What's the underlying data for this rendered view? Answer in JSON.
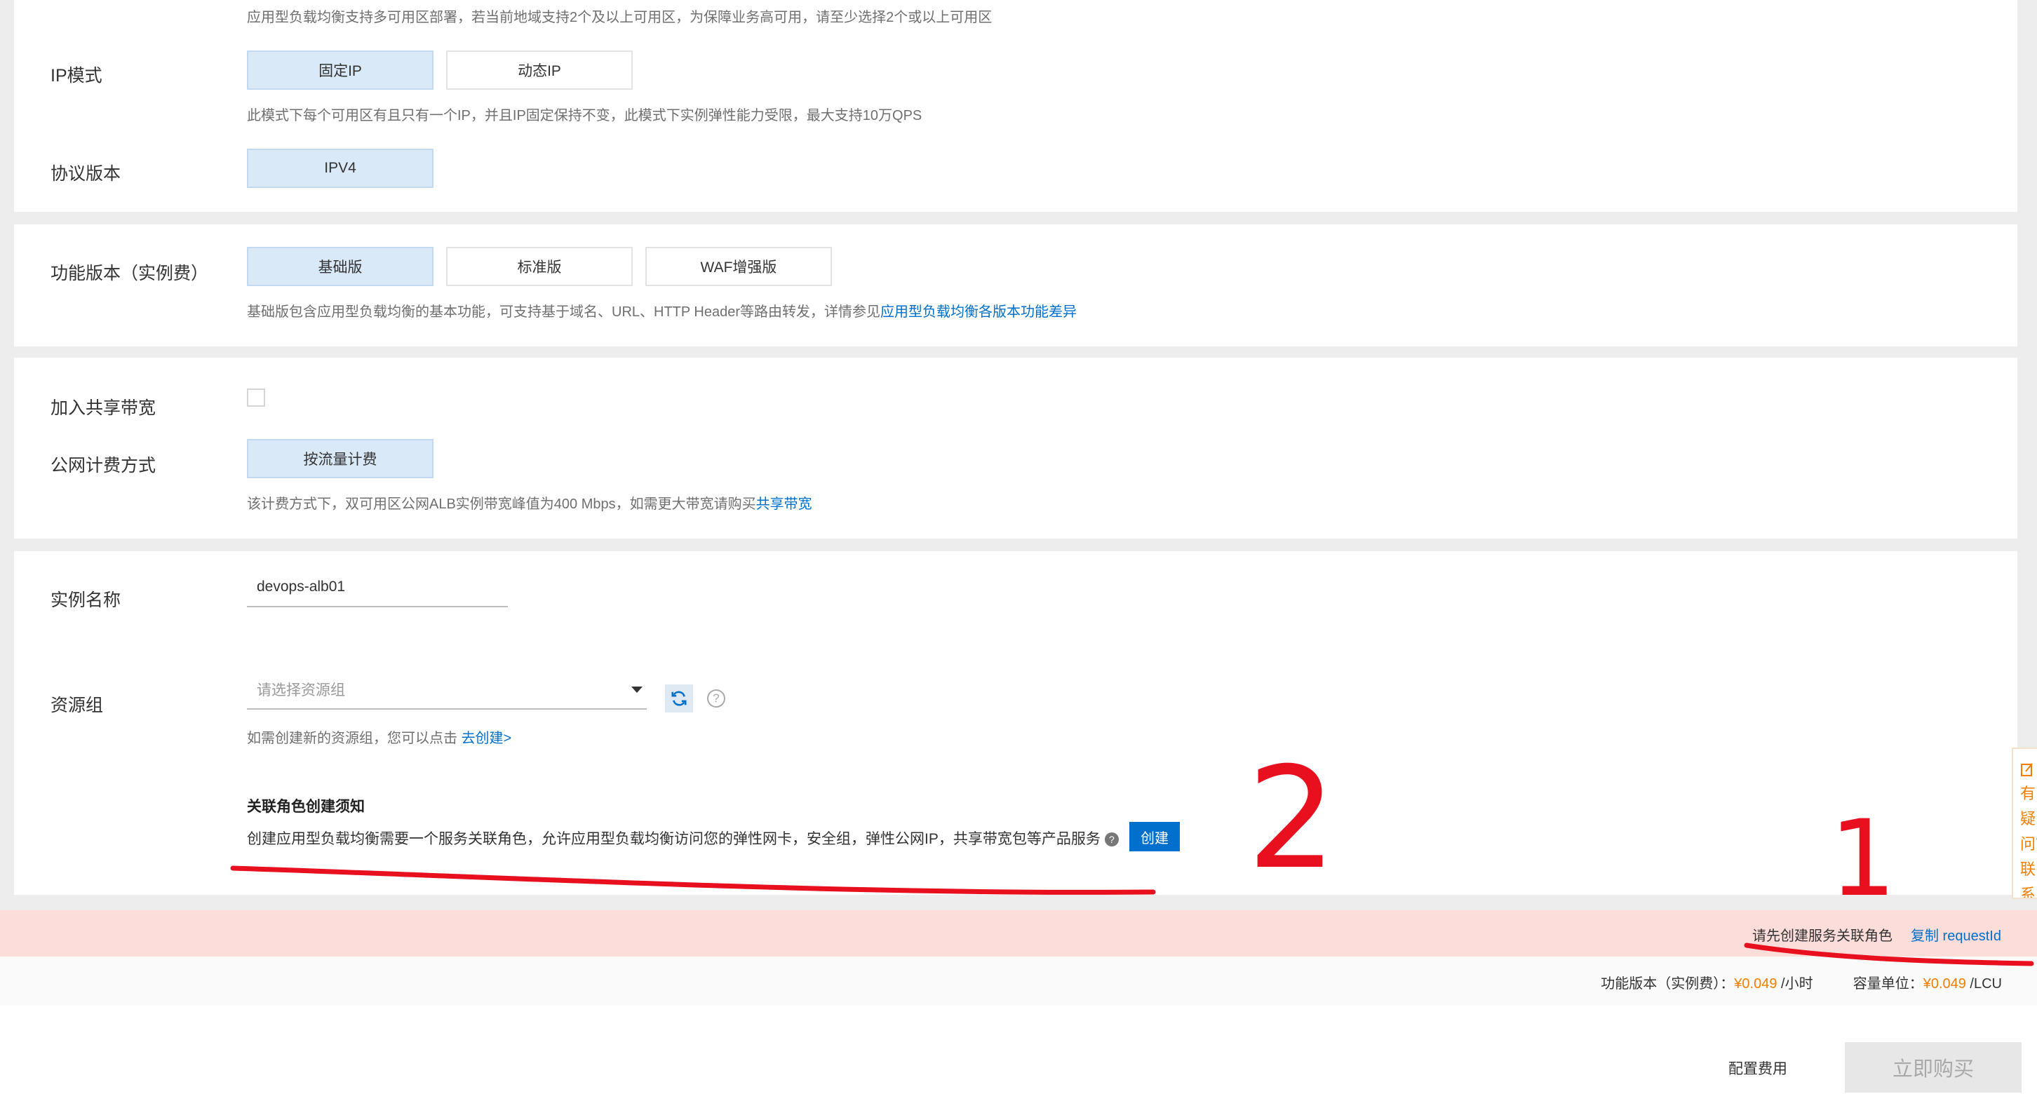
{
  "zone_section": {
    "help": "应用型负载均衡支持多可用区部署，若当前地域支持2个及以上可用区，为保障业务高可用，请至少选择2个或以上可用区"
  },
  "ip_mode": {
    "label": "IP模式",
    "options": [
      "固定IP",
      "动态IP"
    ],
    "selected": "固定IP",
    "help": "此模式下每个可用区有且只有一个IP，并且IP固定保持不变，此模式下实例弹性能力受限，最大支持10万QPS"
  },
  "protocol": {
    "label": "协议版本",
    "options": [
      "IPV4"
    ],
    "selected": "IPV4"
  },
  "edition": {
    "label": "功能版本（实例费）",
    "options": [
      "基础版",
      "标准版",
      "WAF增强版"
    ],
    "selected": "基础版",
    "help_prefix": "基础版包含应用型负载均衡的基本功能，可支持基于域名、URL、HTTP Header等路由转发，详情参见",
    "help_link": "应用型负载均衡各版本功能差异"
  },
  "bandwidth": {
    "shared_label": "加入共享带宽",
    "shared_checked": false,
    "billing_label": "公网计费方式",
    "billing_options": [
      "按流量计费"
    ],
    "billing_selected": "按流量计费",
    "help_prefix": "该计费方式下，双可用区公网ALB实例带宽峰值为400 Mbps，如需更大带宽请购买",
    "help_link": "共享带宽"
  },
  "instance": {
    "name_label": "实例名称",
    "name_value": "devops-alb01",
    "rg_label": "资源组",
    "rg_placeholder": "请选择资源组",
    "rg_help_prefix": "如需创建新的资源组，您可以点击 ",
    "rg_help_link": "去创建>"
  },
  "notice": {
    "title": "关联角色创建须知",
    "text": "创建应用型负载均衡需要一个服务关联角色，允许应用型负载均衡访问您的弹性网卡，安全组，弹性公网IP，共享带宽包等产品服务",
    "button": "创建"
  },
  "error_bar": {
    "message": "请先创建服务关联角色",
    "copy_link": "复制 requestId"
  },
  "fees": {
    "edition_label": "功能版本（实例费）：",
    "edition_price": "¥0.049",
    "edition_unit": " /小时",
    "capacity_label": "容量单位：",
    "capacity_price": "¥0.049",
    "capacity_unit": " /LCU"
  },
  "footer": {
    "config_fee": "配置费用",
    "buy_button": "立即购买"
  },
  "float_tab": {
    "text": "有疑问？联系"
  },
  "annotations": {
    "mark_1": "1",
    "mark_2": "2",
    "color": "#e8101e"
  },
  "colors": {
    "primary": "#0070cc",
    "selected_bg": "#d9e9f8",
    "error_bg": "#fdddd9",
    "price": "#f27f00"
  }
}
